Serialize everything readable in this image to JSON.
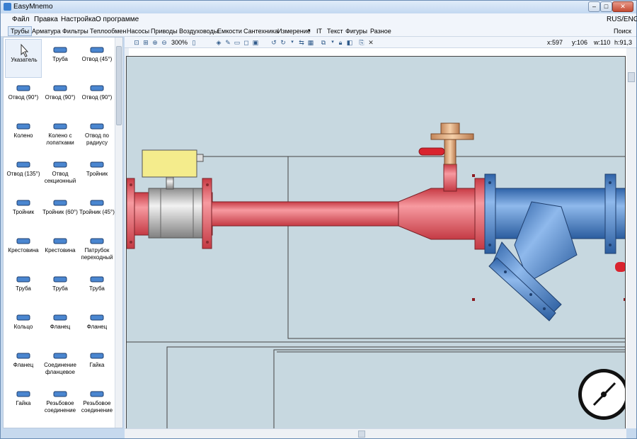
{
  "window": {
    "title": "EasyMnemo",
    "lang": "RUS/ENG",
    "search": "Поиск"
  },
  "menu": [
    "Файл",
    "Правка",
    "Настройка",
    "О программе"
  ],
  "categories": [
    "Трубы",
    "Арматура",
    "Фильтры",
    "Теплообмен",
    "Насосы",
    "Приводы",
    "Воздуховоды",
    "Емкости",
    "Сантехника",
    "Измерение",
    "IT",
    "Текст",
    "Фигуры",
    "Разное"
  ],
  "tools": [
    "Указатель",
    "Труба",
    "Отвод (45°)",
    "Отвод (90°)",
    "Отвод (90°)",
    "Отвод (90°)",
    "Колено",
    "Колено с лопатками",
    "Отвод по радиусу",
    "Отвод (135°)",
    "Отвод секционный",
    "Тройник",
    "Тройник",
    "Тройник (60°)",
    "Тройник (45°)",
    "Крестовина",
    "Крестовина",
    "Патрубок переходный",
    "Труба",
    "Труба",
    "Труба",
    "Кольцо",
    "Фланец",
    "Фланец",
    "Фланец",
    "Соединение фланцевое",
    "Гайка",
    "Гайка",
    "Резьбовое соединение",
    "Резьбовое соединение"
  ],
  "toolbar": {
    "zoom": "300%",
    "x": "x:597",
    "y": "y:106",
    "w": "w:110",
    "h": "h:91,3",
    "units": "px"
  },
  "colors": {
    "accent": "#3a7fd0",
    "pipe_red": "#e05a62",
    "pipe_blue": "#4a86d0",
    "canvas_bg": "#c7d8e0"
  }
}
